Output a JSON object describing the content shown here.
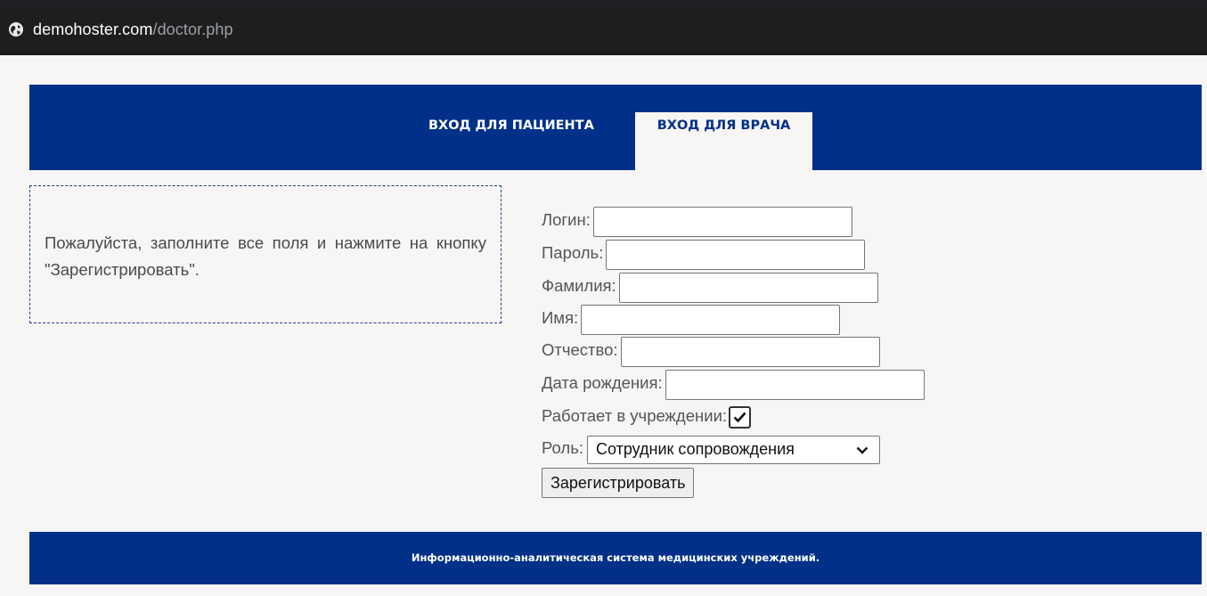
{
  "browser": {
    "url_host": "demohoster.com",
    "url_path": "/doctor.php"
  },
  "header": {
    "tabs": [
      {
        "label": "ВХОД ДЛЯ ПАЦИЕНТА",
        "active": false
      },
      {
        "label": "ВХОД ДЛЯ ВРАЧА",
        "active": true
      }
    ]
  },
  "info": {
    "text": "Пожалуйста, заполните все поля и нажмите на кнопку \"Зарегистрировать\"."
  },
  "form": {
    "login_label": "Логин:",
    "login_value": "",
    "password_label": "Пароль:",
    "password_value": "",
    "surname_label": "Фамилия:",
    "surname_value": "",
    "name_label": "Имя:",
    "name_value": "",
    "patronymic_label": "Отчество:",
    "patronymic_value": "",
    "birthdate_label": "Дата рождения:",
    "birthdate_value": "",
    "works_label": "Работает в учреждении:",
    "works_checked": true,
    "role_label": "Роль:",
    "role_selected": "Сотрудник сопровождения",
    "submit_label": "Зарегистрировать"
  },
  "footer": {
    "text": "Информационно-аналитическая система медицинских учреждений."
  },
  "colors": {
    "brand_blue": "#003087",
    "page_bg": "#f8f6f4"
  },
  "icons": {
    "address_bar": "globe-icon",
    "checkbox": "checkmark-icon",
    "select": "chevron-down-icon"
  }
}
